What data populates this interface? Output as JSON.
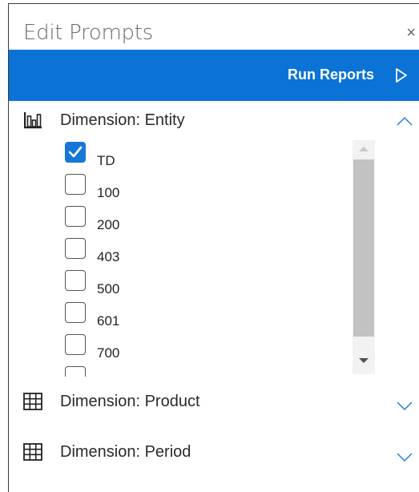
{
  "panel": {
    "title": "Edit Prompts",
    "close_glyph": "×"
  },
  "run_bar": {
    "label": "Run Reports",
    "icon": "play-icon"
  },
  "sections": [
    {
      "label": "Dimension: Entity",
      "icon": "bar-chart-icon",
      "expanded": true,
      "items": [
        {
          "label": "TD",
          "checked": true
        },
        {
          "label": "100",
          "checked": false
        },
        {
          "label": "200",
          "checked": false
        },
        {
          "label": "403",
          "checked": false
        },
        {
          "label": "500",
          "checked": false
        },
        {
          "label": "601",
          "checked": false
        },
        {
          "label": "700",
          "checked": false
        },
        {
          "label": "",
          "checked": false
        }
      ]
    },
    {
      "label": "Dimension: Product",
      "icon": "grid-icon",
      "expanded": false
    },
    {
      "label": "Dimension: Period",
      "icon": "grid-icon",
      "expanded": false
    }
  ],
  "colors": {
    "accent": "#0B73D6",
    "checkbox_checked": "#1677D9",
    "scroll_thumb": "#C2C2C2"
  }
}
